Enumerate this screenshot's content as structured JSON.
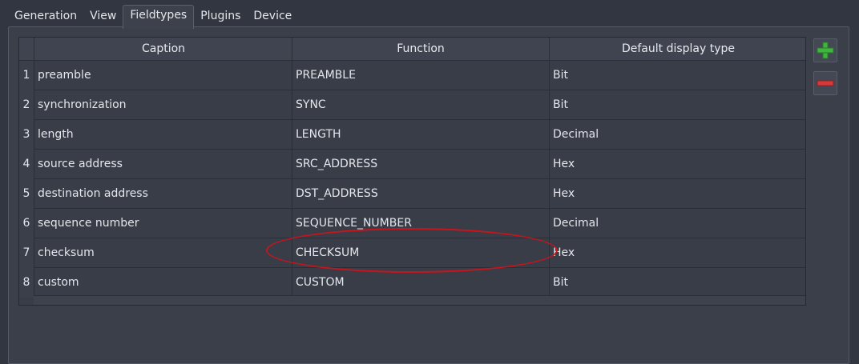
{
  "tabs": [
    {
      "label": "Generation"
    },
    {
      "label": "View"
    },
    {
      "label": "Fieldtypes"
    },
    {
      "label": "Plugins"
    },
    {
      "label": "Device"
    }
  ],
  "active_tab": "Fieldtypes",
  "table": {
    "columns": [
      "Caption",
      "Function",
      "Default display type"
    ],
    "rows": [
      {
        "num": "1",
        "caption": "preamble",
        "function": "PREAMBLE",
        "display": "Bit"
      },
      {
        "num": "2",
        "caption": "synchronization",
        "function": "SYNC",
        "display": "Bit"
      },
      {
        "num": "3",
        "caption": "length",
        "function": "LENGTH",
        "display": "Decimal"
      },
      {
        "num": "4",
        "caption": "source address",
        "function": "SRC_ADDRESS",
        "display": "Hex"
      },
      {
        "num": "5",
        "caption": "destination address",
        "function": "DST_ADDRESS",
        "display": "Hex"
      },
      {
        "num": "6",
        "caption": "sequence number",
        "function": "SEQUENCE_NUMBER",
        "display": "Decimal"
      },
      {
        "num": "7",
        "caption": "checksum",
        "function": "CHECKSUM",
        "display": "Hex"
      },
      {
        "num": "8",
        "caption": "custom",
        "function": "CUSTOM",
        "display": "Bit"
      }
    ]
  },
  "buttons": {
    "add_icon": "plus-icon",
    "remove_icon": "minus-icon"
  },
  "colors": {
    "add": "#3fb43f",
    "remove": "#d9383a",
    "annotation": "#c9141c"
  }
}
